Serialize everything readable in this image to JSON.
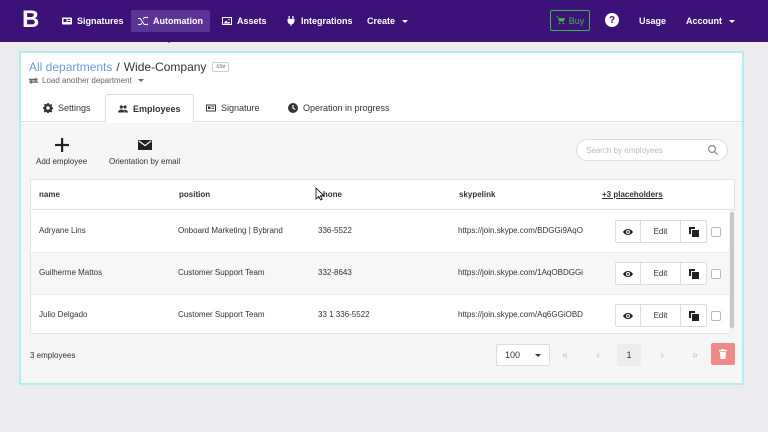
{
  "nav": {
    "logo": "B",
    "items": [
      {
        "label": "Signatures",
        "icon": "id-card-icon"
      },
      {
        "label": "Automation",
        "icon": "shuffle-icon"
      },
      {
        "label": "Assets",
        "icon": "image-icon"
      },
      {
        "label": "Integrations",
        "icon": "plug-icon"
      },
      {
        "label": "Create",
        "icon": ""
      }
    ],
    "buy_label": "Buy",
    "help_label": "?",
    "usage_label": "Usage",
    "account_label": "Account"
  },
  "breadcrumb": {
    "root": "All departments",
    "separator": "/",
    "current": "Wide-Company",
    "badge": "csv"
  },
  "load_department": "Load another department",
  "tabs": [
    {
      "label": "Settings",
      "icon": "gear-icon"
    },
    {
      "label": "Employees",
      "icon": "users-icon"
    },
    {
      "label": "Signature",
      "icon": "id-card-icon"
    },
    {
      "label": "Operation in progress",
      "icon": "clock-icon"
    }
  ],
  "actions": {
    "add_employee": "Add employee",
    "orientation_email": "Orientation by email"
  },
  "search": {
    "placeholder": "Search by employees",
    "value": ""
  },
  "table": {
    "columns": [
      "name",
      "position",
      "phone",
      "skypelink",
      "+3 placeholders"
    ],
    "rows": [
      {
        "name": "Adryane Lins",
        "position": "Onboard Marketing | Bybrand",
        "phone": "336-5522",
        "skypelink": "https://join.skype.com/BDGGi9AqO"
      },
      {
        "name": "Guilherme Mattos",
        "position": "Customer Support Team",
        "phone": "332-8643",
        "skypelink": "https://join.skype.com/1AqOBDGGi"
      },
      {
        "name": "Julio Delgado",
        "position": "Customer Support Team",
        "phone": "33 1 336-5522",
        "skypelink": "https://join.skype.com/Aq6GGiOBD"
      }
    ],
    "edit_label": "Edit"
  },
  "footer": {
    "count": "3 employees",
    "per_page": "100",
    "first": "«",
    "prev": "‹",
    "page": "1",
    "next": "›",
    "last": "»"
  },
  "colors": {
    "nav_bg": "#3d1278",
    "accent_link": "#6a9bd6",
    "buy_green": "#3cb44b",
    "delete_red": "#f08a8a",
    "card_border": "#aef0f2"
  }
}
